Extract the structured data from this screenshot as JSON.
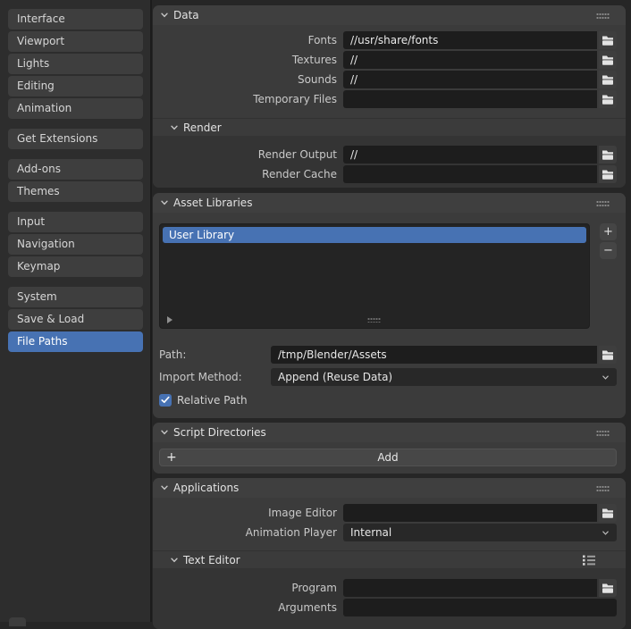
{
  "colors": {
    "accent": "#4772b3",
    "panel": "#3b3b3b",
    "field": "#1d1d1d",
    "nav_bg": "#2d2d2d"
  },
  "sidebar": {
    "groups": [
      {
        "items": [
          {
            "label": "Interface"
          },
          {
            "label": "Viewport"
          },
          {
            "label": "Lights"
          },
          {
            "label": "Editing"
          },
          {
            "label": "Animation"
          }
        ]
      },
      {
        "items": [
          {
            "label": "Get Extensions"
          }
        ]
      },
      {
        "items": [
          {
            "label": "Add-ons"
          },
          {
            "label": "Themes"
          }
        ]
      },
      {
        "items": [
          {
            "label": "Input"
          },
          {
            "label": "Navigation"
          },
          {
            "label": "Keymap"
          }
        ]
      },
      {
        "items": [
          {
            "label": "System"
          },
          {
            "label": "Save & Load"
          },
          {
            "label": "File Paths"
          }
        ]
      }
    ],
    "selected": "File Paths"
  },
  "panels": {
    "data": {
      "title": "Data",
      "rows": [
        {
          "label": "Fonts",
          "value": "//usr/share/fonts"
        },
        {
          "label": "Textures",
          "value": "//"
        },
        {
          "label": "Sounds",
          "value": "//"
        },
        {
          "label": "Temporary Files",
          "value": ""
        }
      ],
      "render": {
        "title": "Render",
        "rows": [
          {
            "label": "Render Output",
            "value": "//"
          },
          {
            "label": "Render Cache",
            "value": ""
          }
        ]
      }
    },
    "asset_libraries": {
      "title": "Asset Libraries",
      "list": [
        {
          "label": "User Library",
          "selected": true
        }
      ],
      "add_button": "+",
      "remove_button": "−",
      "path_label": "Path:",
      "path_value": "/tmp/Blender/Assets",
      "import_label": "Import Method:",
      "import_value": "Append (Reuse Data)",
      "relative_path_label": "Relative Path",
      "relative_path_checked": true
    },
    "script_directories": {
      "title": "Script Directories",
      "add_label": "Add",
      "add_plus": "+"
    },
    "applications": {
      "title": "Applications",
      "rows": [
        {
          "label": "Image Editor",
          "value": ""
        },
        {
          "label": "Animation Player",
          "value": "Internal"
        }
      ],
      "text_editor": {
        "title": "Text Editor",
        "rows": [
          {
            "label": "Program",
            "value": ""
          },
          {
            "label": "Arguments",
            "value": ""
          }
        ]
      }
    }
  },
  "icons": {
    "chevron": "chevron-down",
    "folder": "folder-browse",
    "grip": "drag-dots",
    "check": "checkmark",
    "list": "bullet-list"
  }
}
